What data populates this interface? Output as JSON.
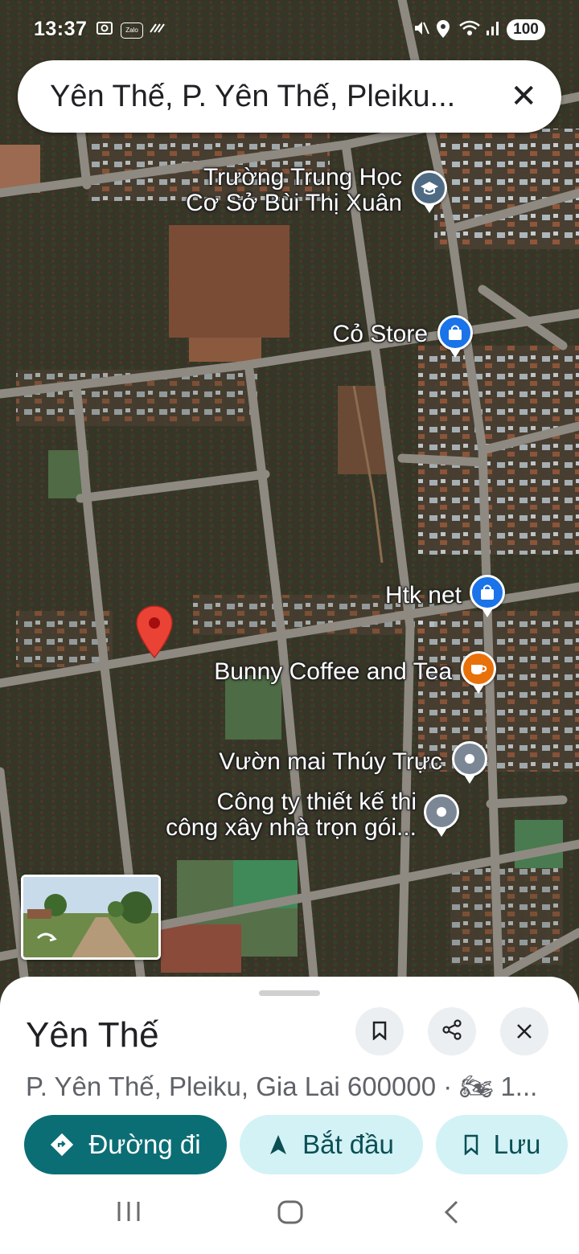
{
  "status_bar": {
    "time": "13:37",
    "zalo_label": "Zalo",
    "battery": "100"
  },
  "search": {
    "query": "Yên Thế, P. Yên Thế, Pleiku..."
  },
  "pois": [
    {
      "name": "school",
      "line1": "Trường Trung Học",
      "line2": "Cơ Sở Bùi Thị Xuân",
      "icon": "school-icon",
      "color": "#4f6b84"
    },
    {
      "name": "co-store",
      "line1": "Cỏ Store",
      "icon": "shopping-bag-icon",
      "color": "#1a73e8"
    },
    {
      "name": "htk-net",
      "line1": "Htk net",
      "icon": "shopping-bag-icon",
      "color": "#1a73e8"
    },
    {
      "name": "bunny-coffee",
      "line1": "Bunny Coffee and Tea",
      "icon": "coffee-icon",
      "color": "#e8710a"
    },
    {
      "name": "vuon-mai",
      "line1": "Vườn mai Thúy Trực",
      "icon": "place-icon",
      "color": "#7b8794"
    },
    {
      "name": "cong-ty",
      "line1": "Công ty thiết kế thi",
      "line2": "công xây nhà trọn gói...",
      "icon": "place-icon",
      "color": "#7b8794"
    }
  ],
  "colors": {
    "accent": "#0b6e74",
    "pill_light": "#d3f2f5",
    "pin_red": "#ea4335"
  },
  "sheet": {
    "title": "Yên Thế",
    "address": "P. Yên Thế, Pleiku, Gia Lai 600000 · 🏍 1...",
    "directions_label": "Đường đi",
    "start_label": "Bắt đầu",
    "save_label": "Lưu"
  }
}
